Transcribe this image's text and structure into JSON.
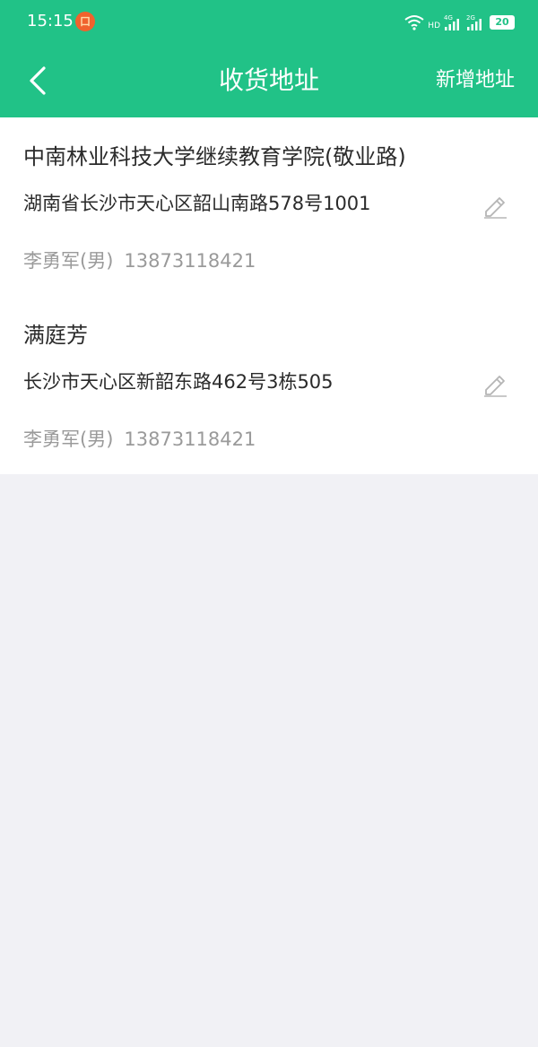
{
  "status_bar": {
    "time": "15:15",
    "notification_glyph": "口",
    "network_hd": "HD",
    "network_4g": "4G",
    "network_2g": "2G",
    "battery": "20"
  },
  "header": {
    "title": "收货地址",
    "add_label": "新增地址"
  },
  "addresses": [
    {
      "name": "中南林业科技大学继续教育学院(敬业路)",
      "detail": "湖南省长沙市天心区韶山南路578号1001",
      "contact_name": "李勇军(男)",
      "phone": "13873118421"
    },
    {
      "name": "满庭芳",
      "detail": "长沙市天心区新韶东路462号3栋505",
      "contact_name": "李勇军(男)",
      "phone": "13873118421"
    }
  ],
  "colors": {
    "brand": "#21c287",
    "background": "#f1f1f5",
    "primary_text": "#2b2b2b",
    "secondary_text": "#9a9a9a"
  },
  "icons": {
    "back": "chevron-left-icon",
    "edit": "pencil-icon"
  }
}
